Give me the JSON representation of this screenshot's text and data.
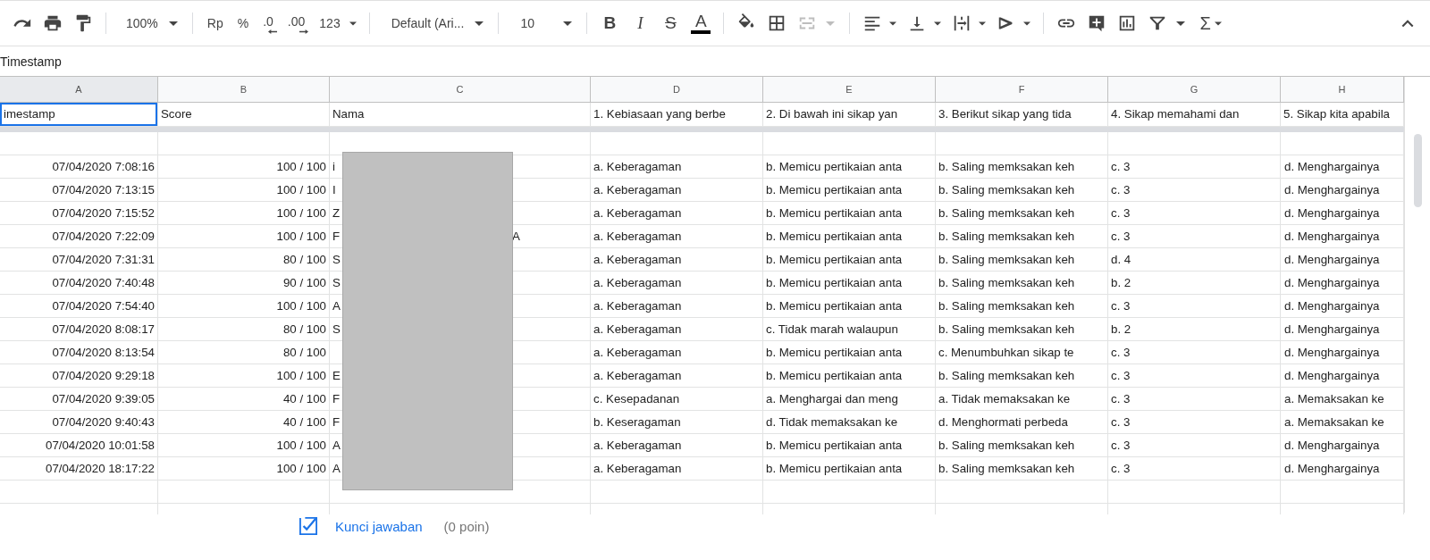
{
  "toolbar": {
    "zoom": "100%",
    "currency": "Rp",
    "percent": "%",
    "decrease_decimals": ".0",
    "increase_decimals": ".00",
    "number_format": "123",
    "font": "Default (Ari...",
    "font_size": "10",
    "text_format": [
      "B",
      "I",
      "S",
      "A"
    ],
    "merge_disabled": true,
    "functions": "Σ"
  },
  "formula_bar": {
    "value": "Timestamp"
  },
  "columns": [
    {
      "letter": "A",
      "selected": true
    },
    {
      "letter": "B",
      "selected": false
    },
    {
      "letter": "C",
      "selected": false
    },
    {
      "letter": "D",
      "selected": false
    },
    {
      "letter": "E",
      "selected": false
    },
    {
      "letter": "F",
      "selected": false
    },
    {
      "letter": "G",
      "selected": false
    },
    {
      "letter": "H",
      "selected": false
    }
  ],
  "header_row": [
    "imestamp",
    "Score",
    "Nama",
    "1. Kebiasaan yang berbe",
    "2. Di bawah ini sikap yan",
    "3. Berikut sikap yang tida",
    "4. Sikap memahami dan",
    "5. Sikap kita apabila"
  ],
  "rows": [
    {
      "timestamp": "07/04/2020 7:08:16",
      "score": "100 / 100",
      "name": "i",
      "answers": [
        "a. Keberagaman",
        "b. Memicu pertikaian anta",
        "b. Saling memksakan keh",
        "c. 3",
        "d. Menghargainya"
      ]
    },
    {
      "timestamp": "07/04/2020 7:13:15",
      "score": "100 / 100",
      "name": "I",
      "answers": [
        "a. Keberagaman",
        "b. Memicu pertikaian anta",
        "b. Saling memksakan keh",
        "c. 3",
        "d. Menghargainya"
      ]
    },
    {
      "timestamp": "07/04/2020 7:15:52",
      "score": "100 / 100",
      "name": "Z",
      "answers": [
        "a. Keberagaman",
        "b. Memicu pertikaian anta",
        "b. Saling memksakan keh",
        "c. 3",
        "d. Menghargainya"
      ]
    },
    {
      "timestamp": "07/04/2020 7:22:09",
      "score": "100 / 100",
      "name": "F",
      "name_end": "A",
      "answers": [
        "a. Keberagaman",
        "b. Memicu pertikaian anta",
        "b. Saling memksakan keh",
        "c. 3",
        "d. Menghargainya"
      ]
    },
    {
      "timestamp": "07/04/2020 7:31:31",
      "score": "80 / 100",
      "name": "S",
      "answers": [
        "a. Keberagaman",
        "b. Memicu pertikaian anta",
        "b. Saling memksakan keh",
        "d. 4",
        "d. Menghargainya"
      ]
    },
    {
      "timestamp": "07/04/2020 7:40:48",
      "score": "90 / 100",
      "name": "S",
      "answers": [
        "a. Keberagaman",
        "b. Memicu pertikaian anta",
        "b. Saling memksakan keh",
        "b. 2",
        "d. Menghargainya"
      ]
    },
    {
      "timestamp": "07/04/2020 7:54:40",
      "score": "100 / 100",
      "name": "A",
      "answers": [
        "a. Keberagaman",
        "b. Memicu pertikaian anta",
        "b. Saling memksakan keh",
        "c. 3",
        "d. Menghargainya"
      ]
    },
    {
      "timestamp": "07/04/2020 8:08:17",
      "score": "80 / 100",
      "name": "S",
      "answers": [
        "a. Keberagaman",
        "c. Tidak marah walaupun",
        "b. Saling memksakan keh",
        "b. 2",
        "d. Menghargainya"
      ]
    },
    {
      "timestamp": "07/04/2020 8:13:54",
      "score": "80 / 100",
      "answers": [
        "a. Keberagaman",
        "b. Memicu pertikaian anta",
        "c. Menumbuhkan sikap te",
        "c. 3",
        "d. Menghargainya"
      ]
    },
    {
      "timestamp": "07/04/2020 9:29:18",
      "score": "100 / 100",
      "name": "E",
      "answers": [
        "a. Keberagaman",
        "b. Memicu pertikaian anta",
        "b. Saling memksakan keh",
        "c. 3",
        "d. Menghargainya"
      ]
    },
    {
      "timestamp": "07/04/2020 9:39:05",
      "score": "40 / 100",
      "name": "F",
      "answers": [
        "c. Kesepadanan",
        "a. Menghargai dan meng",
        "a. Tidak memaksakan ke",
        "c. 3",
        "a. Memaksakan ke"
      ]
    },
    {
      "timestamp": "07/04/2020 9:40:43",
      "score": "40 / 100",
      "name": "F",
      "answers": [
        "b. Keseragaman",
        "d. Tidak memaksakan ke",
        "d. Menghormati perbeda",
        "c. 3",
        "a. Memaksakan ke"
      ]
    },
    {
      "timestamp": "07/04/2020 10:01:58",
      "score": "100 / 100",
      "name": "A",
      "answers": [
        "a. Keberagaman",
        "b. Memicu pertikaian anta",
        "b. Saling memksakan keh",
        "c. 3",
        "d. Menghargainya"
      ]
    },
    {
      "timestamp": "07/04/2020 18:17:22",
      "score": "100 / 100",
      "name": "A",
      "answers": [
        "a. Keberagaman",
        "b. Memicu pertikaian anta",
        "b. Saling memksakan keh",
        "c. 3",
        "d. Menghargainya"
      ]
    }
  ],
  "answer_key": {
    "checked": true,
    "label": "Kunci jawaban",
    "points": "(0 poin)"
  }
}
